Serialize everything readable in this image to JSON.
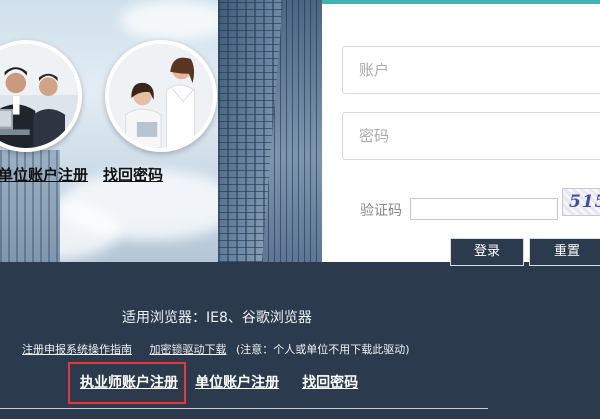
{
  "hero": {
    "unit_register_link": "单位账户注册",
    "recover_password_link": "找回密码"
  },
  "login": {
    "account_placeholder": "账户",
    "password_placeholder": "密码",
    "captcha_label": "验证码",
    "captcha_text": "5154",
    "login_button": "登录",
    "reset_button": "重置",
    "accent_color": "#3fb5b3"
  },
  "footer": {
    "browser_note": "适用浏览器：IE8、谷歌浏览器",
    "guide_link": "注册申报系统操作指南",
    "driver_link": "加密锁驱动下载",
    "driver_note": "(注意：个人或单位不用下载此驱动)",
    "practitioner_register_link": "执业师账户注册",
    "unit_register_link": "单位账户注册",
    "recover_password_link": "找回密码",
    "highlight_color": "#e53935",
    "background_color": "#2b3a4c"
  }
}
